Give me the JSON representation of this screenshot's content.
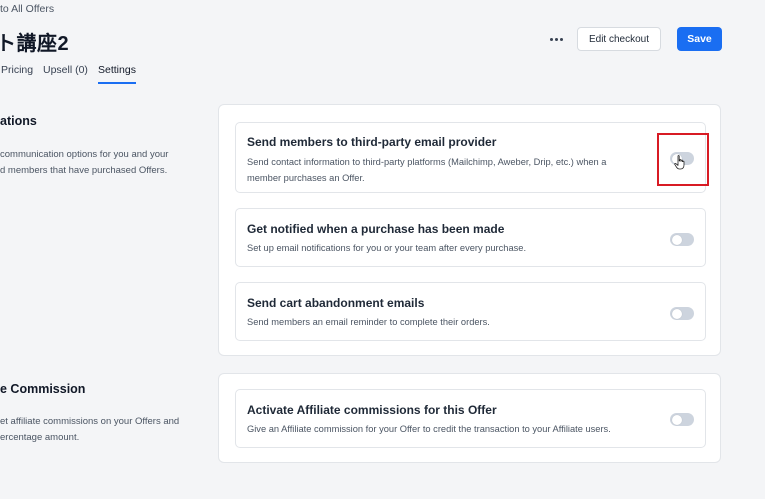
{
  "breadcrumb": {
    "label": "to All Offers"
  },
  "header": {
    "title": "ト講座2",
    "more_label": "•••",
    "edit_checkout_label": "Edit checkout",
    "save_label": "Save"
  },
  "tabs": [
    {
      "label": "Pricing",
      "active": false
    },
    {
      "label": "Upsell (0)",
      "active": false
    },
    {
      "label": "Settings",
      "active": true
    }
  ],
  "notifications_section": {
    "title": "ations",
    "desc_line1": "communication options for you and your",
    "desc_line2": "d members that have purchased Offers.",
    "items": [
      {
        "title": "Send members to third-party email provider",
        "desc_line1": "Send contact information to third-party platforms (Mailchimp, Aweber, Drip, etc.) when a",
        "desc_line2": "member purchases an Offer.",
        "enabled": false
      },
      {
        "title": "Get notified when a purchase has been made",
        "desc_line1": "Set up email notifications for you or your team after every purchase.",
        "enabled": false
      },
      {
        "title": "Send cart abandonment emails",
        "desc_line1": "Send members an email reminder to complete their orders.",
        "enabled": false
      }
    ]
  },
  "affiliate_section": {
    "title": "e Commission",
    "desc_line1": "et affiliate commissions on your Offers and",
    "desc_line2": "ercentage amount.",
    "item": {
      "title": "Activate Affiliate commissions for this Offer",
      "desc_line1": "Give an Affiliate commission for your Offer to credit the transaction to your Affiliate users.",
      "enabled": false
    }
  },
  "colors": {
    "accent": "#1a6ef2",
    "highlight": "#d81b24",
    "toggle_off": "#cdd4de"
  }
}
